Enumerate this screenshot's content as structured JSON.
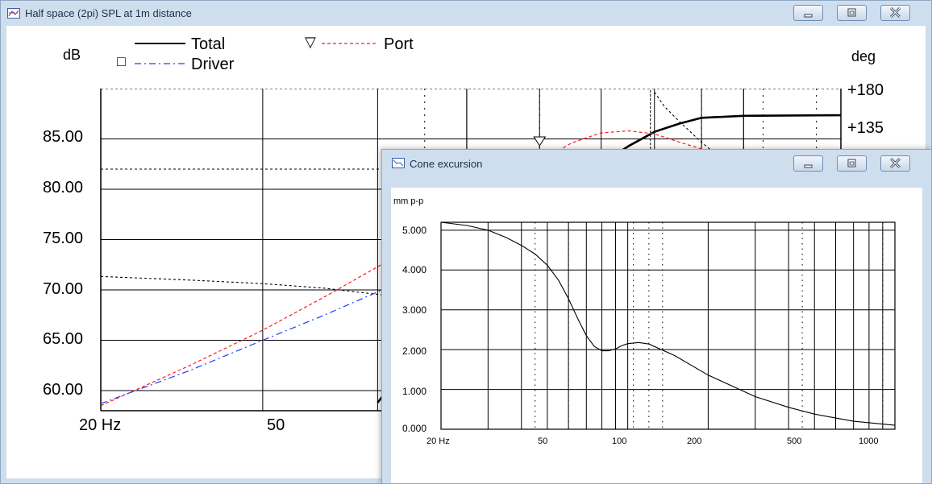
{
  "main_window": {
    "title": "Half space (2pi) SPL at 1m distance",
    "y_left_unit": "dB",
    "y_right_unit": "deg",
    "legend": {
      "total": "Total",
      "driver": "Driver",
      "port": "Port",
      "driver_marker": "□",
      "port_marker": "▽"
    },
    "y_ticks": [
      "85.00",
      "80.00",
      "75.00",
      "70.00",
      "65.00",
      "60.00"
    ],
    "x_ticks": [
      "20 Hz",
      "50"
    ],
    "phase_ticks": [
      "+180",
      "+135"
    ]
  },
  "excursion_window": {
    "title": "Cone excursion",
    "y_unit": "mm p-p",
    "y_ticks": [
      "5.000",
      "4.000",
      "3.000",
      "2.000",
      "1.000",
      "0.000"
    ],
    "x_ticks": [
      "20 Hz",
      "50",
      "100",
      "200",
      "500",
      "1000"
    ]
  },
  "colors": {
    "total": "#000000",
    "driver": "#1f3cff",
    "port": "#ff1a1a",
    "phase": "#000000",
    "window_frame": "#cfdeee"
  },
  "icons": [
    "minimize-icon",
    "maximize-icon",
    "close-icon",
    "chart-window-icon"
  ],
  "chart_data": [
    {
      "type": "line",
      "title": "Half space (2pi) SPL at 1m distance",
      "xlabel": "",
      "ylabel": "dB",
      "x_scale": "log",
      "xlim": [
        20,
        1000
      ],
      "ylim": [
        58,
        90
      ],
      "y2label": "deg",
      "y2lim": [
        0,
        180
      ],
      "grid": true,
      "legend": "top",
      "series": [
        {
          "name": "Total",
          "x": [
            40,
            43,
            46,
            50,
            55,
            60,
            65,
            70,
            75,
            80,
            85,
            90,
            100,
            150,
            200,
            300,
            500,
            1000
          ],
          "y": [
            58.8,
            62.5,
            66,
            70,
            73.5,
            77,
            80,
            82.5,
            84.3,
            85.7,
            86.5,
            87.1,
            87.3,
            87.4,
            87.6,
            88,
            88.2,
            88.3
          ]
        },
        {
          "name": "Driver",
          "x": [
            20,
            25,
            30,
            35,
            40,
            45,
            50,
            55,
            60,
            65,
            70,
            75,
            80
          ],
          "y": [
            58.7,
            62,
            65,
            67.5,
            69.8,
            72,
            73.6,
            74.7,
            75.3,
            75.5,
            75.2,
            74.9,
            75.1
          ]
        },
        {
          "name": "Port",
          "x": [
            20,
            25,
            30,
            35,
            40,
            45,
            50,
            55,
            60,
            65,
            70,
            75,
            80,
            85,
            90
          ],
          "y": [
            58.5,
            62.5,
            66,
            69.3,
            72.3,
            75,
            77.7,
            80.3,
            82.7,
            84.6,
            85.6,
            85.8,
            85.5,
            84.7,
            84
          ]
        },
        {
          "name": "",
          "axis": "phase",
          "x": [
            20,
            25,
            30,
            35,
            40,
            45,
            50,
            55,
            60,
            65,
            70,
            75,
            78
          ],
          "y": [
            75,
            73,
            71,
            68.5,
            65,
            62,
            57,
            51,
            43,
            34,
            23,
            12,
            2
          ]
        },
        {
          "name": "",
          "axis": "phase",
          "x": [
            80,
            82,
            85,
            90,
            95,
            100
          ],
          "y": [
            178,
            170,
            162,
            150,
            140,
            134
          ]
        }
      ]
    },
    {
      "type": "line",
      "title": "Cone excursion",
      "xlabel": "",
      "ylabel": "mm p-p",
      "x_scale": "log",
      "xlim": [
        20,
        1000
      ],
      "ylim": [
        0,
        5.2
      ],
      "grid": true,
      "series": [
        {
          "name": "",
          "x": [
            20,
            25,
            30,
            35,
            40,
            45,
            50,
            55,
            60,
            65,
            70,
            75,
            80,
            85,
            90,
            95,
            100,
            110,
            120,
            150,
            200,
            300,
            400,
            500,
            700,
            1000
          ],
          "y": [
            5.2,
            5.12,
            5.0,
            4.82,
            4.62,
            4.4,
            4.12,
            3.75,
            3.28,
            2.78,
            2.35,
            2.08,
            1.97,
            1.97,
            2.02,
            2.1,
            2.15,
            2.18,
            2.14,
            1.85,
            1.36,
            0.82,
            0.55,
            0.38,
            0.2,
            0.1
          ]
        }
      ]
    }
  ]
}
